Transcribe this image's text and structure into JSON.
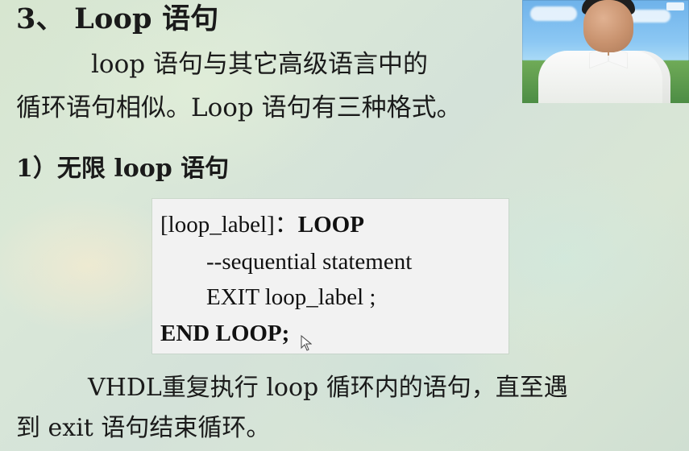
{
  "slide": {
    "title": "3、 Loop 语句",
    "intro": {
      "line1": "loop 语句与其它高级语言中的",
      "line2": "循环语句相似。Loop 语句有三种格式。"
    },
    "subheading": "1）无限 loop 语句",
    "code": {
      "line1_prefix": "[loop_label]：",
      "line1_keyword": "LOOP",
      "line2": "--sequential statement",
      "line3": "EXIT loop_label ;",
      "line4": "END LOOP;"
    },
    "footer": {
      "line1": "VHDL重复执行 loop 循环内的语句，直至遇",
      "line2": "到 exit 语句结束循环。"
    }
  },
  "icons": {
    "cursor": "mouse-pointer-icon"
  }
}
